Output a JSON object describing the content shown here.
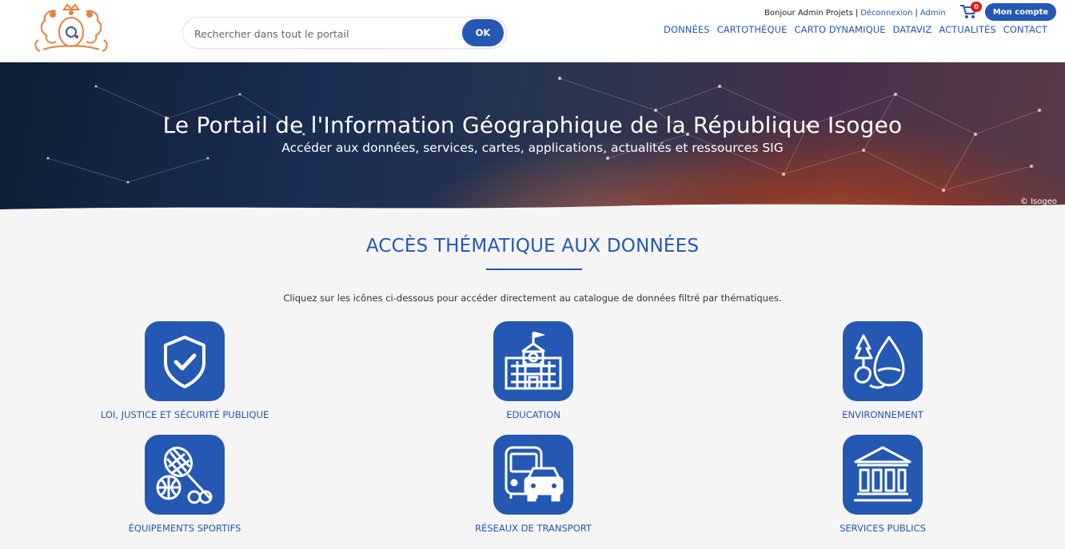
{
  "header": {
    "search": {
      "placeholder": "Rechercher dans tout le portail",
      "button_label": "OK"
    },
    "user": {
      "greeting": "Bonjour Admin Projets",
      "sep1": "|",
      "logout_label": "Déconnexion",
      "sep2": "|",
      "admin_label": "Admin",
      "cart_count": "0",
      "account_label": "Mon compte"
    },
    "nav": [
      {
        "label": "Données"
      },
      {
        "label": "Cartothèque"
      },
      {
        "label": "Carto dynamique"
      },
      {
        "label": "Dataviz"
      },
      {
        "label": "Actualités"
      },
      {
        "label": "Contact"
      }
    ]
  },
  "banner": {
    "title": "Le Portail de l'Information Géographique de la République Isogeo",
    "subtitle": "Accéder aux données, services, cartes, applications, actualités et ressources SIG",
    "credit": "© Isogeo"
  },
  "section": {
    "title": "ACCÈS THÉMATIQUE AUX DONNÉES",
    "description": "Cliquez sur les icônes ci-dessous pour accéder directement au catalogue de données filtré par thématiques.",
    "themes": [
      {
        "label": "Loi, justice et sécurité publique",
        "icon": "shield-check-icon"
      },
      {
        "label": "Education",
        "icon": "school-building-icon"
      },
      {
        "label": "Environnement",
        "icon": "tree-water-icon"
      },
      {
        "label": "Équipements sportifs",
        "icon": "sports-equipment-icon"
      },
      {
        "label": "Réseaux de transport",
        "icon": "bus-car-icon"
      },
      {
        "label": "Services publics",
        "icon": "public-building-icon"
      }
    ]
  },
  "colors": {
    "primary": "#2458b3",
    "logo": "#e8803a",
    "badge": "#e01b1b"
  }
}
